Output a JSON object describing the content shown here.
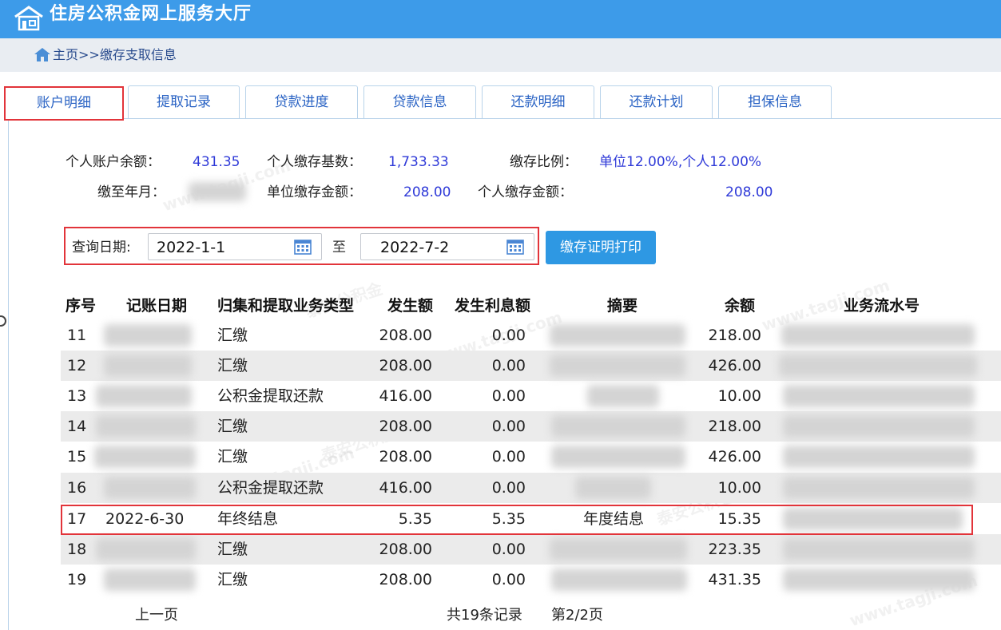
{
  "header": {
    "title": "住房公积金网上服务大厅"
  },
  "breadcrumb": {
    "text": "主页>>缴存支取信息"
  },
  "tabs": [
    {
      "label": "账户明细"
    },
    {
      "label": "提取记录"
    },
    {
      "label": "贷款进度"
    },
    {
      "label": "贷款信息"
    },
    {
      "label": "还款明细"
    },
    {
      "label": "还款计划"
    },
    {
      "label": "担保信息"
    }
  ],
  "summary": {
    "balance_label": "个人账户余额：",
    "balance_value": "431.35",
    "base_label": "个人缴存基数：",
    "base_value": "1,733.33",
    "ratio_label": "缴存比例：",
    "ratio_value": "单位12.00%,个人12.00%",
    "paid_to_label": "缴至年月：",
    "unit_amount_label": "单位缴存金额：",
    "unit_amount_value": "208.00",
    "personal_amount_label": "个人缴存金额：",
    "personal_amount_value": "208.00"
  },
  "query": {
    "label": "查询日期:",
    "from": "2022-1-1",
    "to_label": "至",
    "to": "2022-7-2",
    "print_button": "缴存证明打印"
  },
  "table": {
    "columns": [
      "序号",
      "记账日期",
      "归集和提取业务类型",
      "发生额",
      "发生利息额",
      "摘要",
      "余额",
      "业务流水号"
    ],
    "rows": [
      {
        "no": "11",
        "date": "",
        "type": "汇缴",
        "amount": "208.00",
        "interest": "0.00",
        "summary": "",
        "balance": "218.00"
      },
      {
        "no": "12",
        "date": "",
        "type": "汇缴",
        "amount": "208.00",
        "interest": "0.00",
        "summary": "",
        "balance": "426.00"
      },
      {
        "no": "13",
        "date": "",
        "type": "公积金提取还款",
        "amount": "416.00",
        "interest": "0.00",
        "summary": "",
        "balance": "10.00"
      },
      {
        "no": "14",
        "date": "",
        "type": "汇缴",
        "amount": "208.00",
        "interest": "0.00",
        "summary": "",
        "balance": "218.00"
      },
      {
        "no": "15",
        "date": "",
        "type": "汇缴",
        "amount": "208.00",
        "interest": "0.00",
        "summary": "",
        "balance": "426.00"
      },
      {
        "no": "16",
        "date": "",
        "type": "公积金提取还款",
        "amount": "416.00",
        "interest": "0.00",
        "summary": "",
        "balance": "10.00"
      },
      {
        "no": "17",
        "date": "2022-6-30",
        "type": "年终结息",
        "amount": "5.35",
        "interest": "5.35",
        "summary": "年度结息",
        "balance": "15.35"
      },
      {
        "no": "18",
        "date": "",
        "type": "汇缴",
        "amount": "208.00",
        "interest": "0.00",
        "summary": "",
        "balance": "223.35"
      },
      {
        "no": "19",
        "date": "",
        "type": "汇缴",
        "amount": "208.00",
        "interest": "0.00",
        "summary": "",
        "balance": "431.35"
      }
    ]
  },
  "pager": {
    "prev": "上一页",
    "total": "共19条记录",
    "page": "第2/2页"
  },
  "watermark": {
    "text_site": "www.tagji.com",
    "text_cn": "泰安公积金"
  },
  "colors": {
    "header_bg": "#3d9be9",
    "accent_blue": "#2f3ad8",
    "highlight_red": "#e2343a",
    "button_bg": "#2e98e3"
  }
}
